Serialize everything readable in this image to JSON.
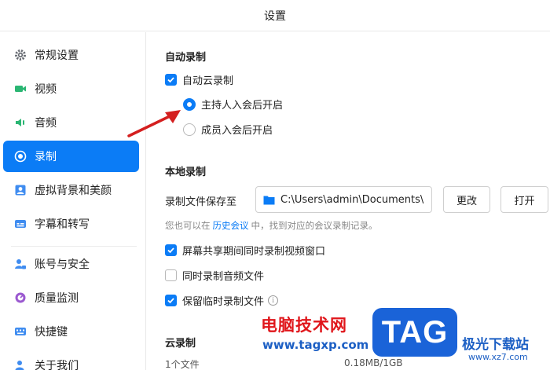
{
  "window": {
    "title": "设置"
  },
  "sidebar": {
    "items": [
      {
        "label": "常规设置",
        "icon": "gear-icon"
      },
      {
        "label": "视频",
        "icon": "video-camera-icon"
      },
      {
        "label": "音频",
        "icon": "speaker-icon"
      },
      {
        "label": "录制",
        "icon": "record-icon",
        "active": true
      },
      {
        "label": "虚拟背景和美颜",
        "icon": "portrait-icon"
      },
      {
        "label": "字幕和转写",
        "icon": "subtitle-icon"
      },
      {
        "label": "账号与安全",
        "icon": "account-lock-icon"
      },
      {
        "label": "质量监测",
        "icon": "monitor-icon"
      },
      {
        "label": "快捷键",
        "icon": "keyboard-icon"
      },
      {
        "label": "关于我们",
        "icon": "info-user-icon"
      }
    ]
  },
  "auto_record": {
    "title": "自动录制",
    "cloud_checkbox": {
      "label": "自动云录制",
      "checked": true
    },
    "options": [
      {
        "label": "主持人入会后开启",
        "checked": true
      },
      {
        "label": "成员入会后开启",
        "checked": false
      }
    ]
  },
  "local_record": {
    "title": "本地录制",
    "save_label": "录制文件保存至",
    "path": "C:\\Users\\admin\\Documents\\",
    "change_button": "更改",
    "open_button": "打开",
    "hint_prefix": "您也可以在",
    "hint_link": "历史会议",
    "hint_suffix": "中，找到对应的会议录制记录。",
    "checkboxes": [
      {
        "label": "屏幕共享期间同时录制视频窗口",
        "checked": true
      },
      {
        "label": "同时录制音频文件",
        "checked": false
      },
      {
        "label": "保留临时录制文件",
        "checked": true
      }
    ]
  },
  "cloud_record": {
    "title": "云录制",
    "file_count": "1个文件",
    "usage": "0.18MB/1GB"
  },
  "watermark": {
    "cn_text": "电脑技术网",
    "url": "www.tagxp.com",
    "tag": "TAG",
    "brand": "极光下载站",
    "brand_url": "www.xz7.com"
  },
  "colors": {
    "accent": "#0b7cf6",
    "arrow": "#d41f1f"
  }
}
